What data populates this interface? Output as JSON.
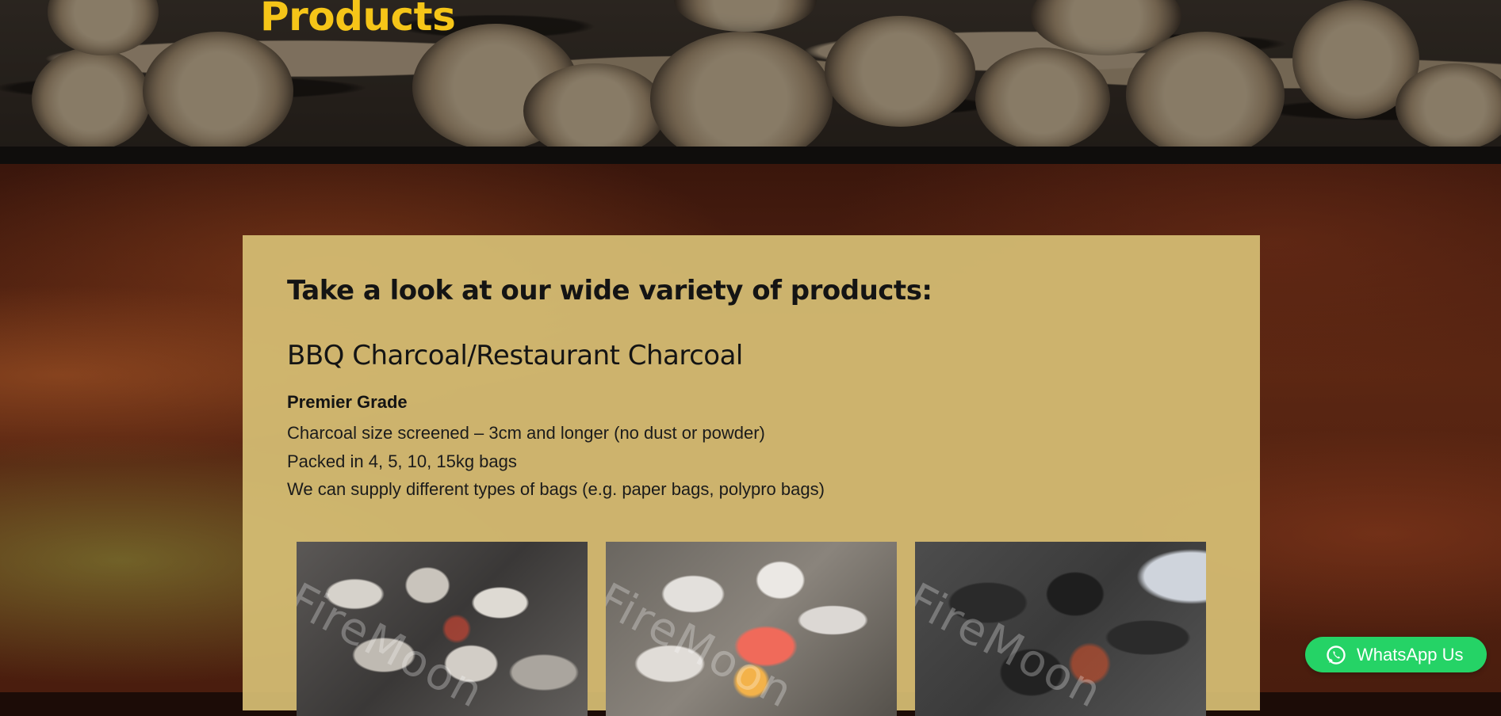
{
  "hero": {
    "title": "Products"
  },
  "content": {
    "heading": "Take a look at our wide variety of products:",
    "subheading": "BBQ Charcoal/Restaurant Charcoal",
    "grade": "Premier Grade",
    "details": [
      "Charcoal size screened – 3cm and longer (no dust or powder)",
      "Packed in 4, 5, 10, 15kg bags",
      "We can supply different types of bags (e.g. paper bags, polypro bags)"
    ]
  },
  "products": {
    "images": [
      {
        "alt": "charcoal-pieces-photo",
        "watermark": "FireMoon"
      },
      {
        "alt": "burning-charcoal-photo",
        "watermark": "FireMoon"
      },
      {
        "alt": "bagged-charcoal-photo",
        "watermark": "FireMoon"
      }
    ]
  },
  "whatsapp": {
    "label": "WhatsApp Us",
    "icon": "whatsapp-icon",
    "color": "#25d366"
  },
  "colors": {
    "title": "#f5c518",
    "card": "#d6be74"
  }
}
